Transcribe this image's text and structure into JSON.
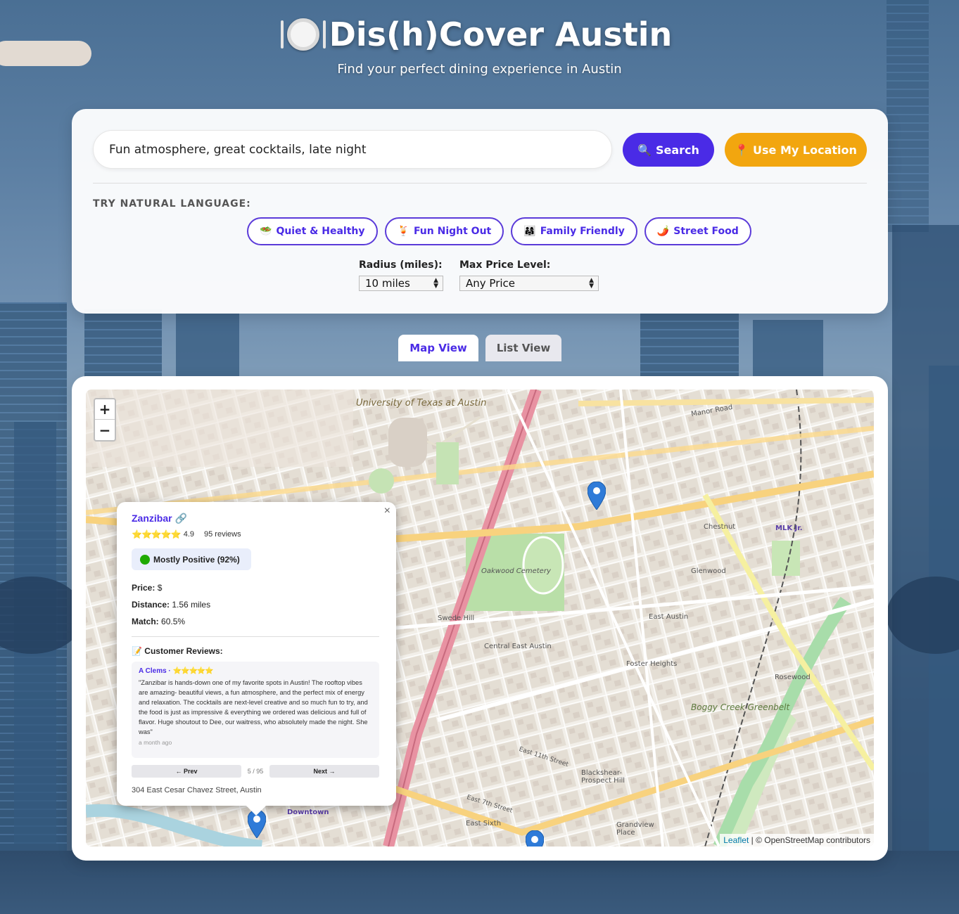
{
  "header": {
    "title": "Dis(h)Cover Austin",
    "title_icon": "plate-icon",
    "subtitle": "Find your perfect dining experience in Austin"
  },
  "search": {
    "value": "Fun atmosphere, great cocktails, late night",
    "search_label": "Search",
    "location_label": "Use My Location",
    "search_icon": "magnifier-icon",
    "location_icon": "pin-icon"
  },
  "colors": {
    "accent": "#4a2be6",
    "location": "#f2a60f"
  },
  "suggestions": {
    "label": "TRY NATURAL LANGUAGE:",
    "chips": [
      {
        "icon": "🥗",
        "label": "Quiet & Healthy"
      },
      {
        "icon": "🍹",
        "label": "Fun Night Out"
      },
      {
        "icon": "👨‍👩‍👧",
        "label": "Family Friendly"
      },
      {
        "icon": "🌶️",
        "label": "Street Food"
      }
    ]
  },
  "filters": {
    "radius_label": "Radius (miles):",
    "radius_value": "10 miles",
    "price_label": "Max Price Level:",
    "price_value": "Any Price"
  },
  "tabs": {
    "map": "Map View",
    "list": "List View"
  },
  "map": {
    "zoom_in": "+",
    "zoom_out": "−",
    "attribution_leaflet": "Leaflet",
    "attribution_rest": "| © OpenStreetMap contributors",
    "labels": {
      "ut": "University of Texas at Austin",
      "oakwood": "Oakwood Cemetery",
      "boggy": "Boggy Creek Greenbelt",
      "mlk": "MLK Jr.",
      "downtown": "Downtown",
      "east_austin": "East Austin",
      "central_east": "Central East Austin",
      "swede_hill": "Swede Hill",
      "chestnut": "Chestnut",
      "glenwood": "Glenwood",
      "foster": "Foster Heights",
      "rosewood": "Rosewood",
      "blackshear": "Blackshear-Prospect Hill",
      "grandview": "Grandview Place",
      "east_sixth": "East Sixth",
      "manor": "Manor Road",
      "e7th": "East 7th Street",
      "e11th": "East 11th Street"
    }
  },
  "popup": {
    "name": "Zanzibar",
    "link_icon": "🔗",
    "stars": "⭐⭐⭐⭐⭐",
    "rating": "4.9",
    "reviews": "95 reviews",
    "sentiment": "Mostly Positive (92%)",
    "price_label": "Price:",
    "price": "$",
    "distance_label": "Distance:",
    "distance": "1.56 miles",
    "match_label": "Match:",
    "match": "60.5%",
    "reviews_title": "📝 Customer Reviews:",
    "review": {
      "author": "A Clems",
      "sep": " · ",
      "stars": "⭐⭐⭐⭐⭐",
      "text": "\"Zanzibar is hands-down one of my favorite spots in Austin! The rooftop vibes are amazing- beautiful views, a fun atmosphere, and the perfect mix of energy and relaxation. The cocktails are next-level creative and so much fun to try, and the food is just as impressive & everything we ordered was delicious and full of flavor. Huge shoutout to Dee, our waitress, who absolutely made the night. She was\"",
      "time": "a month ago"
    },
    "prev": "← Prev",
    "count": "5 / 95",
    "next": "Next →",
    "address": "304 East Cesar Chavez Street, Austin",
    "close": "×"
  }
}
